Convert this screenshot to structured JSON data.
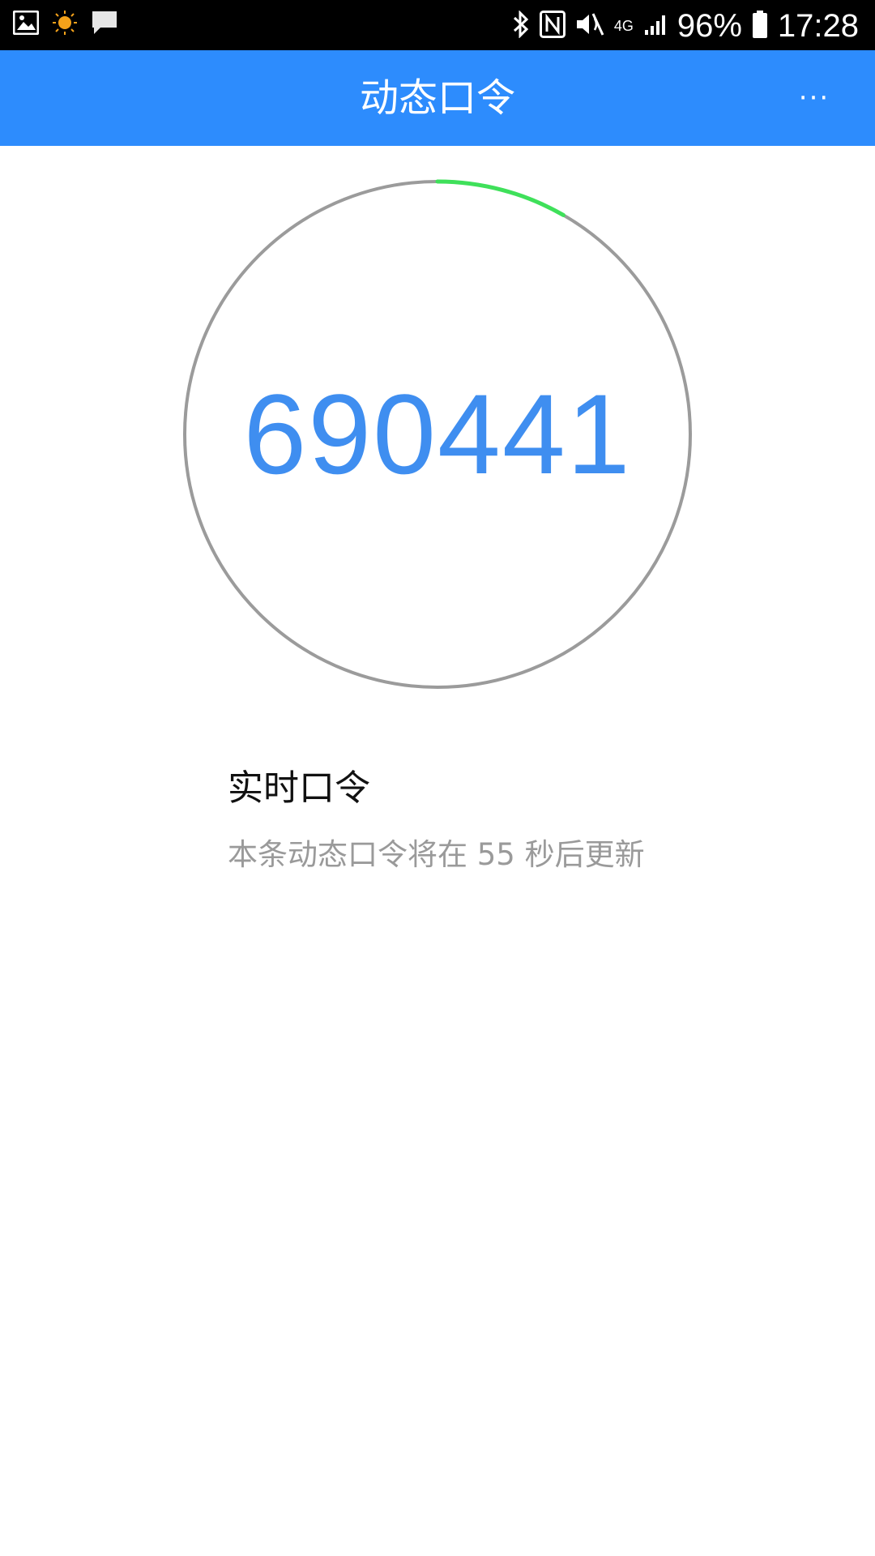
{
  "status_bar": {
    "network": "4G",
    "battery": "96%",
    "time": "17:28"
  },
  "app_bar": {
    "title": "动态口令",
    "more_label": "···"
  },
  "token": {
    "code": "690441",
    "progress_fraction": 0.083,
    "ring_color": "#9b9b9b",
    "progress_color": "#3fe05a",
    "code_color": "#3f8ef0"
  },
  "info": {
    "title": "实时口令",
    "subtitle": "本条动态口令将在 55 秒后更新"
  },
  "colors": {
    "app_bar": "#2d8cfd",
    "status_bar": "#000000"
  }
}
